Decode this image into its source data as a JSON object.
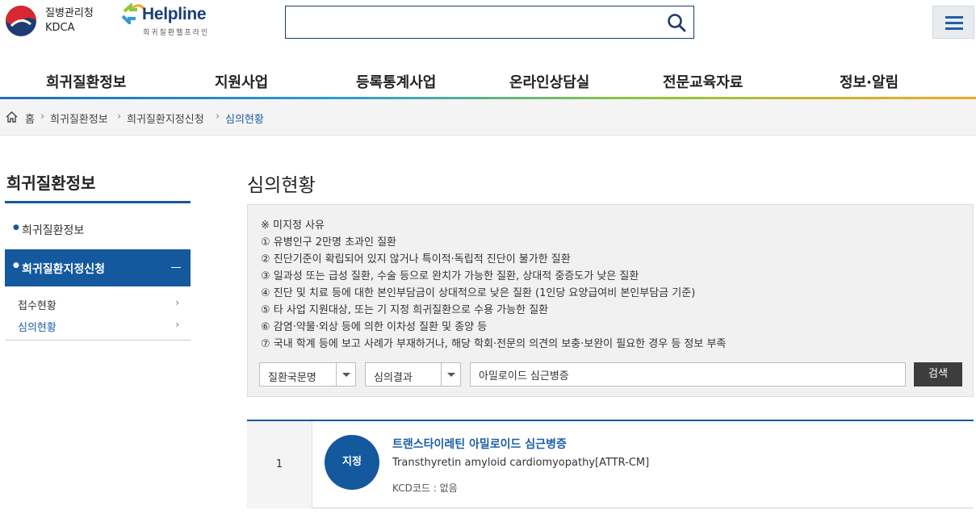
{
  "header": {
    "org_name_ko": "질병관리청",
    "org_name_en": "KDCA",
    "helpline_name": "Helpline",
    "helpline_sub": "희귀질환헬프라인",
    "search_value": ""
  },
  "nav": {
    "items": [
      "희귀질환정보",
      "지원사업",
      "등록통계사업",
      "온라인상담실",
      "전문교육자료",
      "정보·알림"
    ]
  },
  "breadcrumb": {
    "home": "홈",
    "items": [
      "희귀질환정보",
      "희귀질환지정신청",
      "심의현황"
    ]
  },
  "sidebar": {
    "title": "희귀질환정보",
    "item1": "희귀질환정보",
    "active": "희귀질환지정신청",
    "sub": [
      "접수현황",
      "심의현황"
    ]
  },
  "main": {
    "title": "심의현황",
    "notice": [
      "※ 미지정 사유",
      "① 유병인구 2만명 초과인 질환",
      "② 진단기준이 확립되어 있지 않거나 특이적·독립적 진단이 불가한 질환",
      "③ 일과성 또는 급성 질환, 수술 등으로 완치가 가능한 질환, 상대적 중증도가 낮은 질환",
      "④ 진단 및 치료 등에 대한 본인부담금이 상대적으로 낮은 질환 (1인당 요양급여비 본인부담금 기준)",
      "⑤ 타 사업 지원대상, 또는 기 지정 희귀질환으로 수용 가능한 질환",
      "⑥ 감염·약물·외상 등에 의한 이차성 질환 및 종양 등",
      "⑦ 국내 학계 등에 보고 사례가 부재하거나, 해당 학회·전문의 의견의 보충·보완이 필요한 경우 등 정보 부족"
    ],
    "filter": {
      "field_select": "질환국문명",
      "result_select": "심의결과",
      "keyword": "아밀로이드 심근병증",
      "submit": "검색"
    },
    "results": [
      {
        "num": "1",
        "badge": "지정",
        "title_ko": "트랜스타이레틴 아밀로이드 심근병증",
        "title_en": "Transthyretin amyloid cardiomyopathy[ATTR-CM]",
        "kcd": "KCD코드 : 없음"
      }
    ]
  },
  "colors": {
    "primary": "#14589e",
    "link": "#1c5fa5",
    "dark_button": "#3d3d3d"
  }
}
